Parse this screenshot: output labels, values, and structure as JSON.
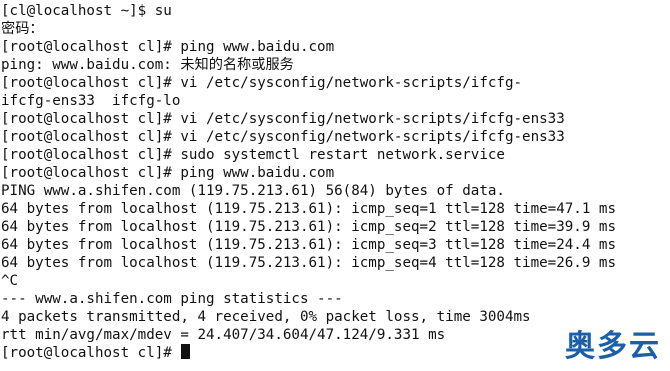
{
  "terminal": {
    "lines": [
      "[cl@localhost ~]$ su",
      "密码：",
      "[root@localhost cl]# ping www.baidu.com",
      "ping: www.baidu.com: 未知的名称或服务",
      "[root@localhost cl]# vi /etc/sysconfig/network-scripts/ifcfg-",
      "ifcfg-ens33  ifcfg-lo",
      "[root@localhost cl]# vi /etc/sysconfig/network-scripts/ifcfg-ens33",
      "[root@localhost cl]# vi /etc/sysconfig/network-scripts/ifcfg-ens33",
      "[root@localhost cl]# sudo systemctl restart network.service",
      "[root@localhost cl]# ping www.baidu.com",
      "PING www.a.shifen.com (119.75.213.61) 56(84) bytes of data.",
      "64 bytes from localhost (119.75.213.61): icmp_seq=1 ttl=128 time=47.1 ms",
      "64 bytes from localhost (119.75.213.61): icmp_seq=2 ttl=128 time=39.9 ms",
      "64 bytes from localhost (119.75.213.61): icmp_seq=3 ttl=128 time=24.4 ms",
      "64 bytes from localhost (119.75.213.61): icmp_seq=4 ttl=128 time=26.9 ms",
      "^C",
      "--- www.a.shifen.com ping statistics ---",
      "4 packets transmitted, 4 received, 0% packet loss, time 3004ms",
      "rtt min/avg/max/mdev = 24.407/34.604/47.124/9.331 ms",
      "[root@localhost cl]# "
    ]
  },
  "watermark": {
    "text": "奥多云",
    "color": "#1a5fa8"
  }
}
